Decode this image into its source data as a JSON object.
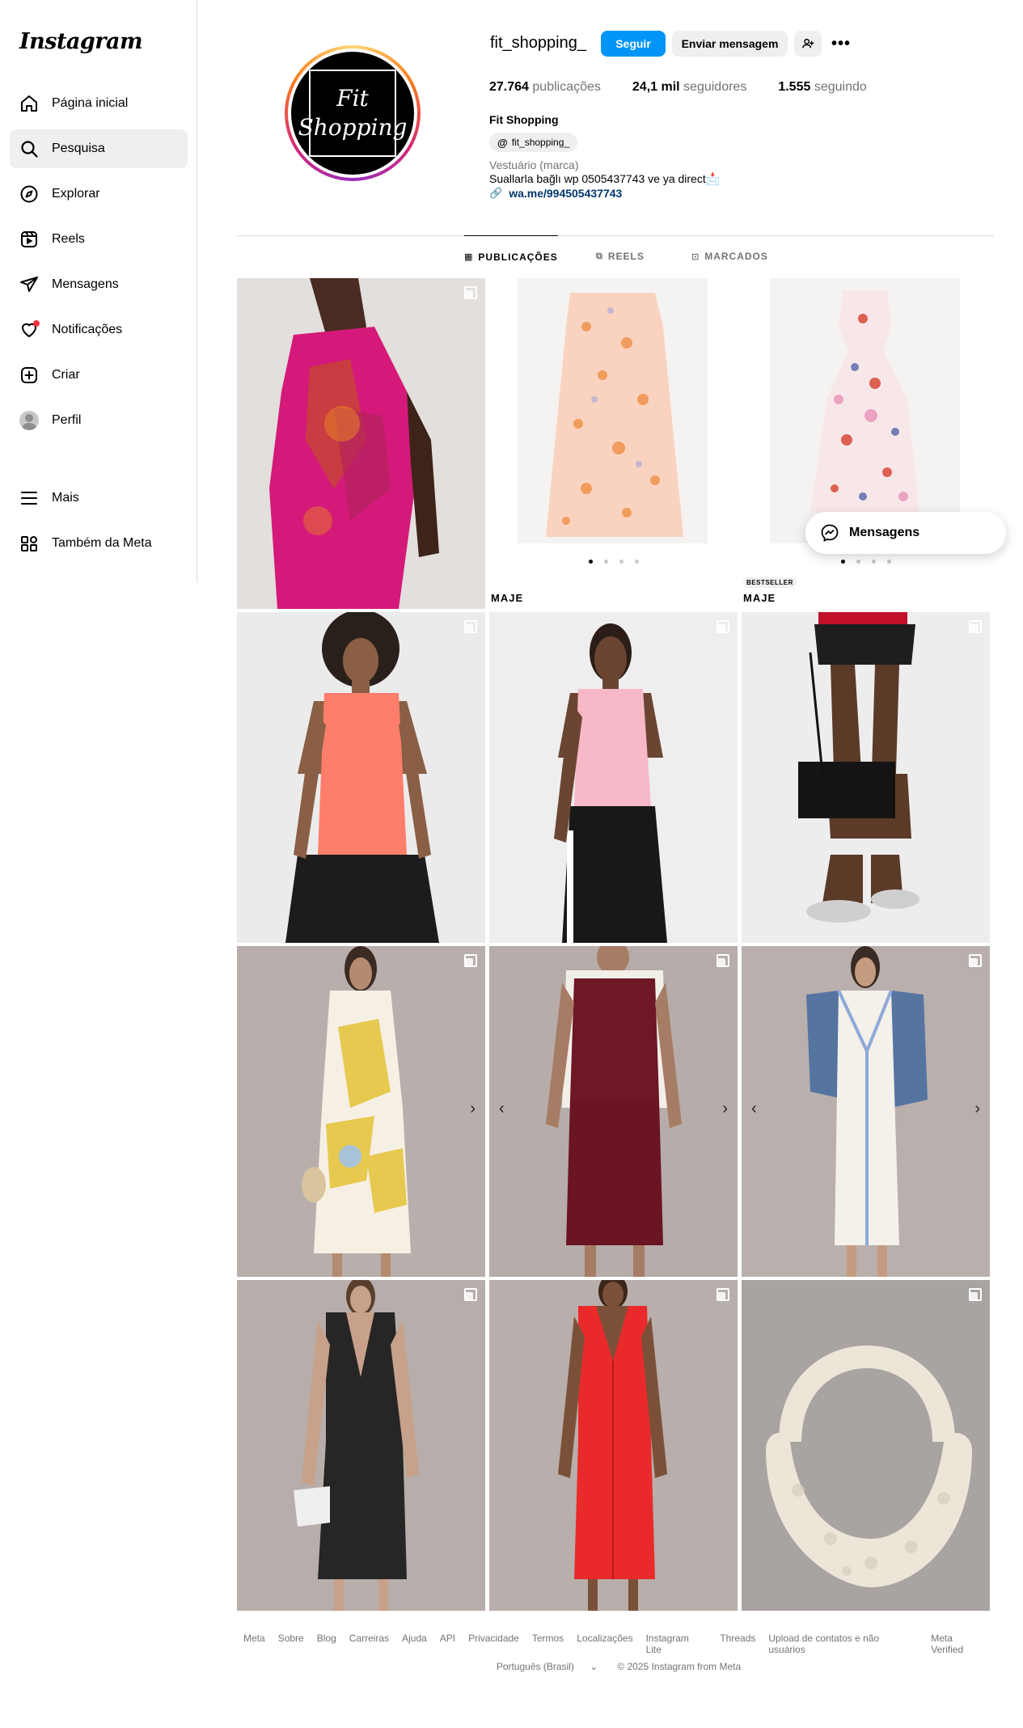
{
  "app": {
    "logo": "Instagram"
  },
  "sidebar": {
    "items": [
      {
        "label": "Página inicial",
        "icon": "home-icon"
      },
      {
        "label": "Pesquisa",
        "icon": "search-icon"
      },
      {
        "label": "Explorar",
        "icon": "compass-icon"
      },
      {
        "label": "Reels",
        "icon": "reels-icon"
      },
      {
        "label": "Mensagens",
        "icon": "paper-plane-icon"
      },
      {
        "label": "Notificações",
        "icon": "heart-icon"
      },
      {
        "label": "Criar",
        "icon": "plus-square-icon"
      },
      {
        "label": "Perfil",
        "icon": "avatar"
      }
    ],
    "more_label": "Mais",
    "meta_label": "Também da Meta"
  },
  "profile": {
    "username": "fit_shopping_",
    "pic_text_line1": "Fit",
    "pic_text_line2": "Shopping",
    "follow_label": "Seguir",
    "message_label": "Enviar mensagem",
    "more_label": "•••",
    "posts_count": "27.764",
    "posts_label": "publicações",
    "followers_count": "24,1 mil",
    "followers_label": "seguidores",
    "following_count": "1.555",
    "following_label": "seguindo",
    "full_name": "Fit Shopping",
    "threads_handle": "fit_shopping_",
    "category": "Vestuário (marca)",
    "bio": "Suallarla bağlı wp 0505437743 ve ya direct📩",
    "link": "wa.me/994505437743"
  },
  "tabs": [
    {
      "label": "PUBLICAÇÕES",
      "icon": "grid-icon"
    },
    {
      "label": "REELS",
      "icon": "reels-icon"
    },
    {
      "label": "MARCADOS",
      "icon": "tagged-icon"
    }
  ],
  "posts": {
    "brand_label": "MAJE",
    "bestseller_label": "BESTSELLER",
    "prev_arrow": "‹",
    "next_arrow": "›"
  },
  "floating": {
    "messages_label": "Mensagens"
  },
  "footer": {
    "links": [
      "Meta",
      "Sobre",
      "Blog",
      "Carreiras",
      "Ajuda",
      "API",
      "Privacidade",
      "Termos",
      "Localizações",
      "Instagram Lite",
      "Threads",
      "Upload de contatos e não usuários",
      "Meta Verified"
    ],
    "language": "Português (Brasil)",
    "copyright": "© 2025 Instagram from Meta"
  },
  "colors": {
    "accent": "#0095f6",
    "notification": "#ff3040",
    "link": "#00376b"
  }
}
